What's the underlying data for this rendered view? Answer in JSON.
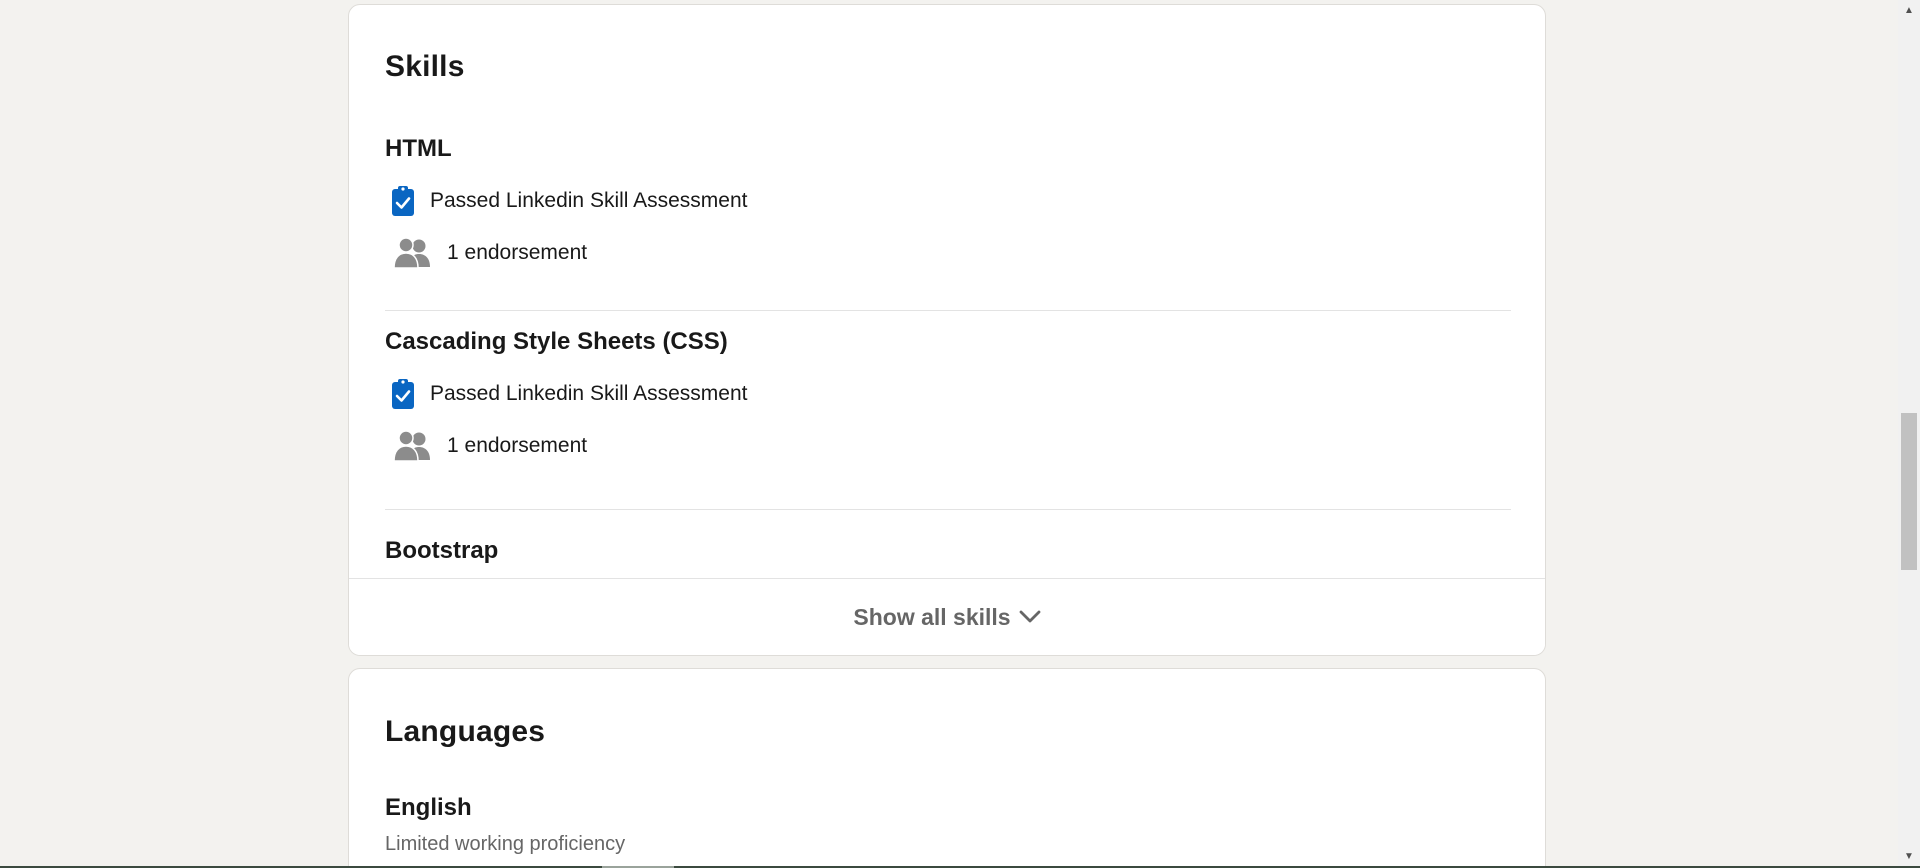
{
  "skills_section": {
    "title": "Skills",
    "items": [
      {
        "name": "HTML",
        "assessment": "Passed Linkedin Skill Assessment",
        "endorsements": "1 endorsement"
      },
      {
        "name": "Cascading Style Sheets (CSS)",
        "assessment": "Passed Linkedin Skill Assessment",
        "endorsements": "1 endorsement"
      },
      {
        "name": "Bootstrap"
      }
    ],
    "show_all_label": "Show all skills"
  },
  "languages_section": {
    "title": "Languages",
    "items": [
      {
        "name": "English",
        "proficiency": "Limited working proficiency"
      }
    ]
  },
  "icons": {
    "assessment": "clipboard-check-icon",
    "endorsement": "people-icon",
    "show_all": "chevron-down-icon"
  },
  "colors": {
    "accent": "#0a66c2",
    "icon_gray": "#8c8c8c",
    "page_background": "#f3f2ef"
  }
}
